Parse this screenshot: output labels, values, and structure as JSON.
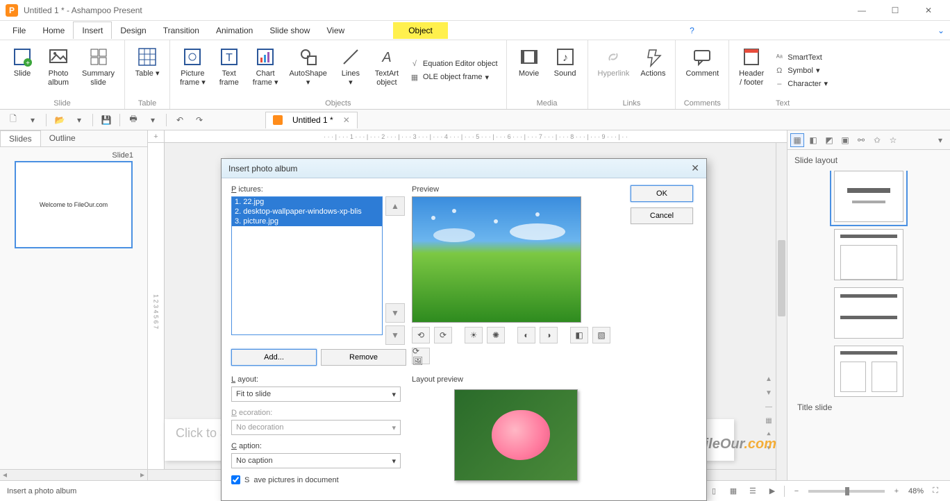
{
  "app": {
    "title": "Untitled 1 * - Ashampoo Present",
    "icon_letter": "P"
  },
  "menu": {
    "file": "File",
    "home": "Home",
    "insert": "Insert",
    "design": "Design",
    "transition": "Transition",
    "animation": "Animation",
    "slideshow": "Slide show",
    "view": "View",
    "object": "Object"
  },
  "ribbon": {
    "slide": "Slide",
    "photo_album": "Photo\nalbum",
    "summary_slide": "Summary\nslide",
    "slide_group": "Slide",
    "table": "Table",
    "table_group": "Table",
    "picture_frame": "Picture\nframe",
    "text_frame": "Text\nframe",
    "chart_frame": "Chart\nframe",
    "autoshape": "AutoShape",
    "lines": "Lines",
    "textart": "TextArt\nobject",
    "eq_editor": "Equation Editor object",
    "ole_frame": "OLE object frame",
    "objects_group": "Objects",
    "movie": "Movie",
    "sound": "Sound",
    "media_group": "Media",
    "hyperlink": "Hyperlink",
    "actions": "Actions",
    "links_group": "Links",
    "comment": "Comment",
    "comments_group": "Comments",
    "header_footer": "Header\n/ footer",
    "smarttext": "SmartText",
    "symbol": "Symbol",
    "character": "Character",
    "text_group": "Text"
  },
  "doc_tab": {
    "name": "Untitled 1 *"
  },
  "left_panel": {
    "slides": "Slides",
    "outline": "Outline",
    "slide1": "Slide1",
    "thumb_text": "Welcome to FileOur.com"
  },
  "canvas": {
    "placeholder": "Click to add no",
    "ruler_h": "· · · | · · · 1 · · · | · · · 2 · · · | · · · 3 · · · | · · · 4 · · · | · · · 5 · · · | · · · 6 · · · | · · · 7 · · · | · · · 8 · · · | · · · 9 · · · | · ·",
    "ruler_v": "1   2   3   4   5   6   7"
  },
  "right_panel": {
    "title": "Slide layout",
    "footer": "Title slide"
  },
  "dialog": {
    "title": "Insert photo album",
    "pictures_label": "Pictures:",
    "pictures": [
      "1. 22.jpg",
      "2. desktop-wallpaper-windows-xp-blis",
      "3. picture.jpg"
    ],
    "preview_label": "Preview",
    "ok": "OK",
    "cancel": "Cancel",
    "add": "Add...",
    "remove": "Remove",
    "layout_label": "Layout:",
    "layout_value": "Fit to slide",
    "decoration_label": "Decoration:",
    "decoration_value": "No decoration",
    "caption_label": "Caption:",
    "caption_value": "No caption",
    "layout_preview_label": "Layout preview",
    "save_pics": "Save pictures in document"
  },
  "status": {
    "text": "Insert a photo album",
    "zoom": "48%"
  },
  "watermark": {
    "a": "F",
    "b": "ileOur",
    "c": ".com"
  }
}
